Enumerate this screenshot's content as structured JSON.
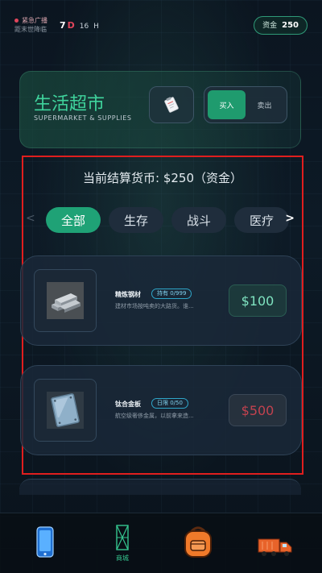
{
  "status": {
    "alert_title": "紧急广播",
    "alert_sub": "距末世降临",
    "day_value": "7",
    "day_unit": "D",
    "hour_value": "16",
    "hour_unit": "H",
    "money_label": "资金",
    "money_value": "250"
  },
  "header": {
    "title": "生活超市",
    "subtitle": "SUPERMARKET & SUPPLIES",
    "clipboard_icon": "clipboard-icon",
    "buy_label": "买入",
    "sell_label": "卖出",
    "active_mode": "buy",
    "accent_color": "#3fd39c"
  },
  "shop": {
    "currency_text": "当前结算货币: $250（资金）",
    "prev_arrow": "<",
    "next_arrow": ">",
    "categories": [
      "全部",
      "生存",
      "战斗",
      "医疗"
    ],
    "active_category": "全部",
    "items": [
      {
        "name": "精炼钢材",
        "tag": "持有 0/999",
        "desc": "建材市场按吨卖的大路货。谁...",
        "price": "$100",
        "affordable": true,
        "icon": "steel-bars-icon"
      },
      {
        "name": "钛合金板",
        "tag": "日限 0/50",
        "desc": "航空级奢侈金属，以前拿来造...",
        "price": "$500",
        "affordable": false,
        "icon": "titanium-plate-icon"
      }
    ]
  },
  "nav": {
    "items": [
      {
        "icon": "phone-icon",
        "label": ""
      },
      {
        "icon": "shop-icon",
        "label": "商城"
      },
      {
        "icon": "backpack-icon",
        "label": ""
      },
      {
        "icon": "truck-icon",
        "label": ""
      }
    ],
    "active_index": 1
  }
}
